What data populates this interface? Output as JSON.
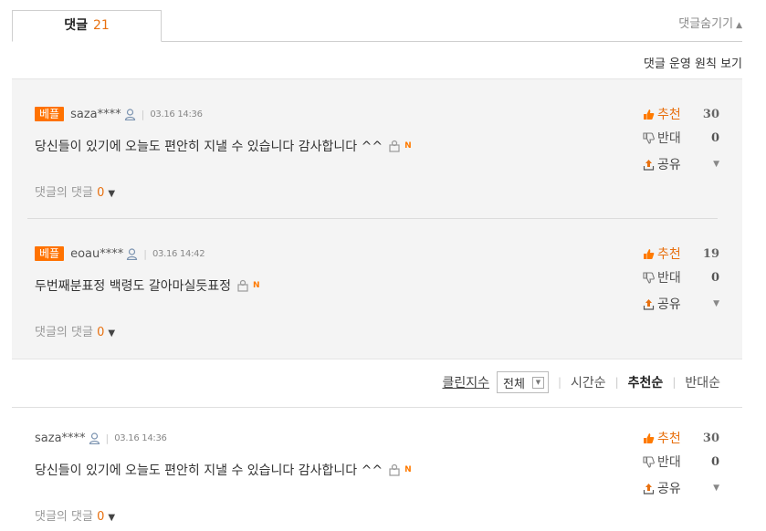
{
  "header": {
    "tab_label": "댓글",
    "tab_count": "21",
    "hide_label": "댓글숨기기",
    "policy_label": "댓글 운영 원칙 보기"
  },
  "comments": [
    {
      "badge": "베플",
      "user": "saza****",
      "date": "03.16 14:36",
      "text": "당신들이 있기에 오늘도 편안히 지낼 수 있습니다 감사합니다 ^^",
      "reply_label": "댓글의 댓글",
      "reply_count": "0",
      "up_label": "추천",
      "up_count": "30",
      "down_label": "반대",
      "down_count": "0",
      "share_label": "공유"
    },
    {
      "badge": "베플",
      "user": "eoau****",
      "date": "03.16 14:42",
      "text": "두번째분표정 백령도 갈아마실듯표정",
      "reply_label": "댓글의 댓글",
      "reply_count": "0",
      "up_label": "추천",
      "up_count": "19",
      "down_label": "반대",
      "down_count": "0",
      "share_label": "공유"
    },
    {
      "badge": "",
      "user": "saza****",
      "date": "03.16 14:36",
      "text": "당신들이 있기에 오늘도 편안히 지낼 수 있습니다 감사합니다 ^^",
      "reply_label": "댓글의 댓글",
      "reply_count": "0",
      "up_label": "추천",
      "up_count": "30",
      "down_label": "반대",
      "down_count": "0",
      "share_label": "공유"
    }
  ],
  "sort": {
    "clean_label": "클린지수",
    "clean_select_value": "전체",
    "options": [
      "시간순",
      "추천순",
      "반대순"
    ],
    "active": "추천순"
  },
  "icons": {
    "user": "user-profile-icon",
    "picture": "photo-icon",
    "new": "N",
    "thumbs_up": "thumbs-up-icon",
    "thumbs_down": "thumbs-down-icon",
    "share": "share-icon"
  },
  "colors": {
    "accent": "#ff7200",
    "count": "#e8700f",
    "best_bg": "#f4f4f4"
  }
}
